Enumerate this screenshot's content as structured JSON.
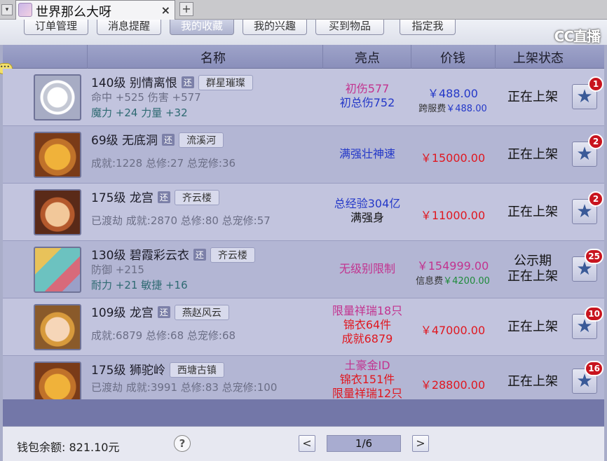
{
  "tab": {
    "title": "世界那么大呀",
    "close": "×",
    "new_tab": "+",
    "dropdown": "▾"
  },
  "logo": "CC直播",
  "subnav": [
    "订单管理",
    "消息提醒",
    "我的收藏",
    "我的兴趣",
    "买到物品",
    "指定我"
  ],
  "header": {
    "name": "名称",
    "highlight": "亮点",
    "price": "价钱",
    "status": "上架状态"
  },
  "rows": [
    {
      "title": "140级  别情离恨",
      "tag": "还",
      "server": "群星璀璨",
      "line2": "命中 +525 伤害 +577",
      "line3": "魔力 +24 力量 +32",
      "hl1": "初伤577",
      "hl1_color": "#c2338f",
      "hl2": "初总伤752",
      "hl2_color": "#2438c8",
      "hl3": "",
      "hl3_color": "",
      "price": "￥488.00",
      "price_color": "#2438c8",
      "fee_label": "跨服费",
      "fee": "￥488.00",
      "fee_color": "#2438c8",
      "status1": "正在上架",
      "status2": "",
      "badge": "1",
      "icon": "ring-item"
    },
    {
      "title": "69级  无底洞",
      "tag": "还",
      "server": "流溪河",
      "line2": "成就:1228 总修:27 总宠修:36",
      "line3": "",
      "hl1": "满强壮神速",
      "hl1_color": "#2438c8",
      "hl2": "",
      "hl2_color": "",
      "hl3": "",
      "hl3_color": "",
      "price": "￥15000.00",
      "price_color": "#e01820",
      "fee_label": "",
      "fee": "",
      "fee_color": "",
      "status1": "正在上架",
      "status2": "",
      "badge": "2",
      "icon": "lion-avatar"
    },
    {
      "title": "175级  龙宫",
      "tag": "还",
      "server": "齐云楼",
      "line2": "已渡劫 成就:2870 总修:80 总宠修:57",
      "line3": "",
      "hl1": "总经验304亿",
      "hl1_color": "#2438c8",
      "hl2": "满强身",
      "hl2_color": "#111111",
      "hl3": "",
      "hl3_color": "",
      "price": "￥11000.00",
      "price_color": "#e01820",
      "fee_label": "",
      "fee": "",
      "fee_color": "",
      "status1": "正在上架",
      "status2": "",
      "badge": "2",
      "icon": "warrior-avatar"
    },
    {
      "title": "130级  碧霞彩云衣",
      "tag": "还",
      "server": "齐云楼",
      "line2": "防御 +215",
      "line3": "耐力 +21 敏捷 +16",
      "hl1": "无级别限制",
      "hl1_color": "#c2338f",
      "hl2": "",
      "hl2_color": "",
      "hl3": "",
      "hl3_color": "",
      "price": "￥154999.00",
      "price_color": "#c2338f",
      "fee_label": "信息费",
      "fee": "￥4200.00",
      "fee_color": "#1e8a3a",
      "status1": "公示期",
      "status2": "正在上架",
      "badge": "25",
      "icon": "robe-item"
    },
    {
      "title": "109级  龙宫",
      "tag": "还",
      "server": "燕赵风云",
      "line2": "成就:6879 总修:68 总宠修:68",
      "line3": "",
      "hl1": "限量祥瑞18只",
      "hl1_color": "#c2338f",
      "hl2": "锦衣64件",
      "hl2_color": "#e01820",
      "hl3": "成就6879",
      "hl3_color": "#e01820",
      "price": "￥47000.00",
      "price_color": "#e01820",
      "fee_label": "",
      "fee": "",
      "fee_color": "",
      "status1": "正在上架",
      "status2": "",
      "badge": "10",
      "icon": "girl-avatar"
    },
    {
      "title": "175级  狮驼岭",
      "tag": "",
      "server": "西塘古镇",
      "line2": "已渡劫 成就:3991 总修:83 总宠修:100",
      "line3": "",
      "hl1": "土豪金ID",
      "hl1_color": "#c2338f",
      "hl2": "锦衣151件",
      "hl2_color": "#e01820",
      "hl3": "限量祥瑞12只",
      "hl3_color": "#e01820",
      "price": "￥28800.00",
      "price_color": "#e01820",
      "fee_label": "",
      "fee": "",
      "fee_color": "",
      "status1": "正在上架",
      "status2": "",
      "badge": "16",
      "icon": "lion-avatar"
    }
  ],
  "footer": {
    "wallet": "钱包余额: 821.10元",
    "help": "?",
    "prev": "<",
    "page": "1/6",
    "next": ">"
  }
}
